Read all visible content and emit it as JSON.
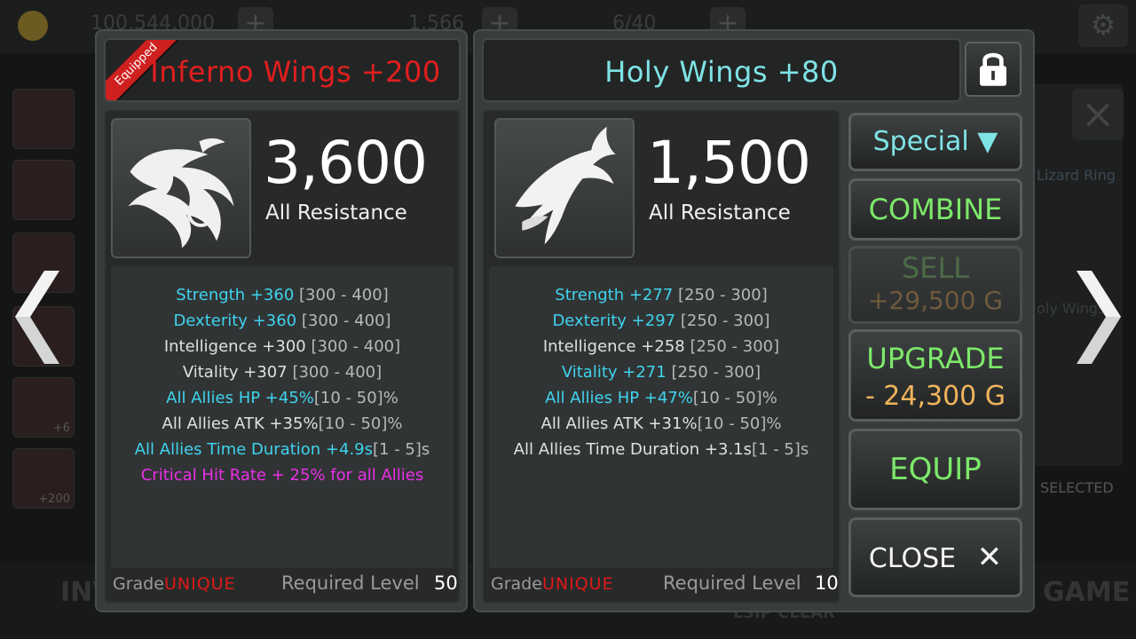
{
  "background": {
    "gold_amount": "100,544,000",
    "gem_amount": "1,566",
    "potion_amount": "6/40",
    "slot_levels": [
      "+6",
      "+200"
    ],
    "side_labels": [
      "Lizard Ring",
      "oly Wings",
      "SELECTED"
    ],
    "bottom_left": "INV",
    "bottom_mid": "L3IP CLEAR",
    "bottom_right": "GAME"
  },
  "left_item": {
    "equipped_label": "Equipped",
    "name": "Inferno Wings +200",
    "main_value": "3,600",
    "main_label": "All Resistance",
    "stats": [
      {
        "text": "Strength +360",
        "range": "[300 - 400]",
        "color": "cyan"
      },
      {
        "text": "Dexterity +360",
        "range": "[300 - 400]",
        "color": "cyan"
      },
      {
        "text": "Intelligence +300",
        "range": "[300 - 400]",
        "color": "white"
      },
      {
        "text": "Vitality +307",
        "range": "[300 - 400]",
        "color": "white"
      },
      {
        "text": "All Allies HP +45%",
        "range": "[10 - 50]%",
        "color": "cyan"
      },
      {
        "text": "All Allies ATK +35%",
        "range": "[10 - 50]%",
        "color": "white"
      },
      {
        "text": "All Allies Time Duration +4.9s",
        "range": "[1 - 5]s",
        "color": "cyan"
      },
      {
        "text": "Critical Hit Rate + 25% for all Allies",
        "range": "",
        "color": "magenta"
      }
    ],
    "grade_label": "Grade",
    "grade_value": "UNIQUE",
    "required_level_label": "Required Level",
    "required_level": "50"
  },
  "right_item": {
    "name": "Holy Wings +80",
    "main_value": "1,500",
    "main_label": "All Resistance",
    "stats": [
      {
        "text": "Strength +277",
        "range": "[250 - 300]",
        "color": "cyan"
      },
      {
        "text": "Dexterity +297",
        "range": "[250 - 300]",
        "color": "cyan"
      },
      {
        "text": "Intelligence +258",
        "range": "[250 - 300]",
        "color": "white"
      },
      {
        "text": "Vitality +271",
        "range": "[250 - 300]",
        "color": "cyan"
      },
      {
        "text": "All Allies HP +47%",
        "range": "[10 - 50]%",
        "color": "cyan"
      },
      {
        "text": "All Allies ATK +31%",
        "range": "[10 - 50]%",
        "color": "white"
      },
      {
        "text": "All Allies Time Duration +3.1s",
        "range": "[1 - 5]s",
        "color": "white"
      }
    ],
    "grade_label": "Grade",
    "grade_value": "UNIQUE",
    "required_level_label": "Required Level",
    "required_level": "10"
  },
  "actions": {
    "special_label": "Special",
    "special_arrow": "▼",
    "combine_label": "COMBINE",
    "sell_label": "SELL",
    "sell_price": "+29,500 G",
    "upgrade_label": "UPGRADE",
    "upgrade_cost": "- 24,300 G",
    "equip_label": "EQUIP",
    "close_label": "CLOSE",
    "close_icon": "✕"
  },
  "colors": {
    "equipped_red": "#e21e1e",
    "item_name_cyan": "#7fe3e6",
    "stat_cyan": "#3fd3ef",
    "stat_magenta": "#ea2fe8",
    "button_green": "#7de86a",
    "gold_text": "#f0b45c"
  }
}
